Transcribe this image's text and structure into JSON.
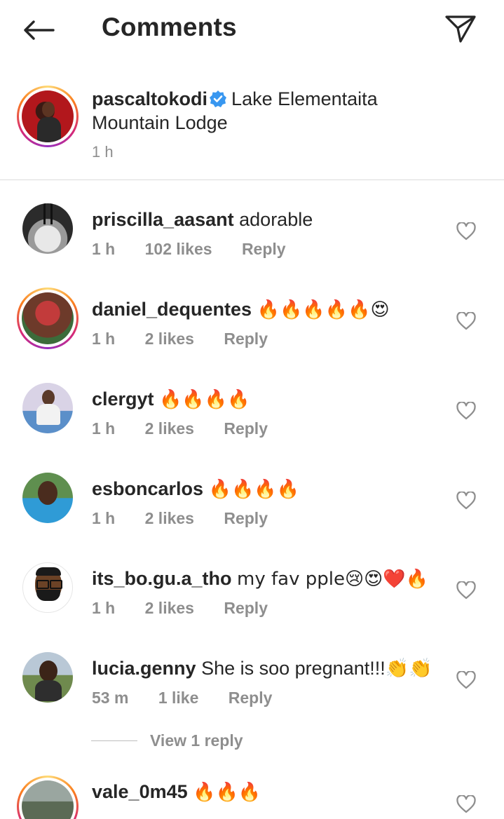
{
  "header": {
    "title": "Comments",
    "back_icon": "arrow-left-icon",
    "send_icon": "paper-plane-icon"
  },
  "caption": {
    "username": "pascaltokodi",
    "verified": true,
    "text": "Lake Elementaita Mountain Lodge",
    "time": "1 h"
  },
  "comments": [
    {
      "username": "priscilla_aasant",
      "text": "adorable",
      "time": "1 h",
      "likes": "102 likes",
      "reply": "Reply"
    },
    {
      "username": "daniel_dequentes",
      "text": "🔥🔥🔥🔥🔥😍",
      "time": "1 h",
      "likes": "2 likes",
      "reply": "Reply"
    },
    {
      "username": "clergyt",
      "text": "🔥🔥🔥🔥",
      "time": "1 h",
      "likes": "2 likes",
      "reply": "Reply"
    },
    {
      "username": "esboncarlos",
      "text": "🔥🔥🔥🔥",
      "time": "1 h",
      "likes": "2 likes",
      "reply": "Reply"
    },
    {
      "username": "its_bo.gu.a_tho",
      "text": "my fav pple😢😍❤️🔥",
      "time": "1 h",
      "likes": "2 likes",
      "reply": "Reply"
    },
    {
      "username": "lucia.genny",
      "text": "She is soo pregnant!!!👏👏",
      "time": "53 m",
      "likes": "1 like",
      "reply": "Reply"
    },
    {
      "username": "vale_0m45",
      "text": "🔥🔥🔥",
      "time": "",
      "likes": "",
      "reply": ""
    }
  ],
  "view_replies": "View 1 reply",
  "colors": {
    "text": "#262626",
    "secondary": "#8e8e8e",
    "verified": "#3897f0"
  }
}
